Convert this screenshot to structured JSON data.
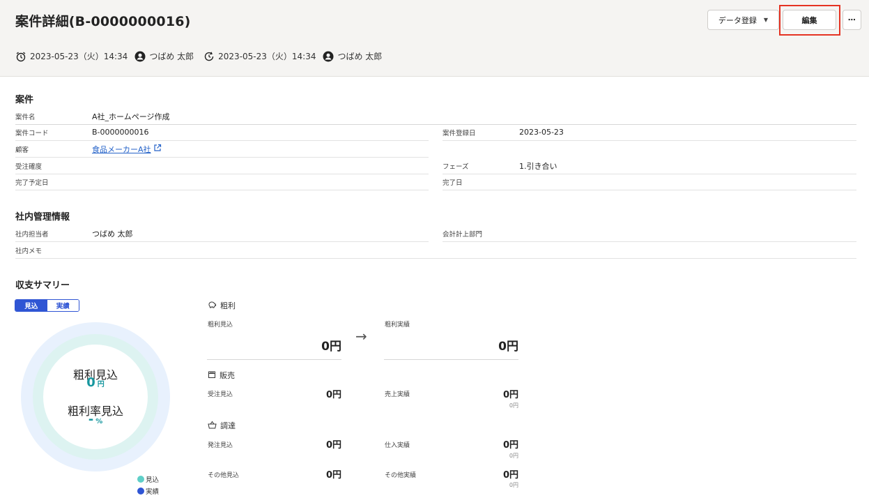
{
  "page": {
    "title": "案件詳細(B-0000000016)",
    "created_at": "2023-05-23（火）14:34",
    "created_by": "つばめ 太郎",
    "updated_at": "2023-05-23（火）14:34",
    "updated_by": "つばめ 太郎"
  },
  "toolbar": {
    "data_register_label": "データ登録",
    "edit_label": "編集",
    "more_label": "⋯"
  },
  "project": {
    "section_title": "案件",
    "name_label": "案件名",
    "name_value": "A社_ホームページ作成",
    "code_label": "案件コード",
    "code_value": "B-0000000016",
    "reg_date_label": "案件登録日",
    "reg_date_value": "2023-05-23",
    "customer_label": "顧客",
    "customer_value": "食品メーカーA社",
    "certainty_label": "受注確度",
    "phase_label": "フェーズ",
    "phase_value": "1.引き合い",
    "due_label": "完了予定日",
    "done_label": "完了日"
  },
  "internal": {
    "section_title": "社内管理情報",
    "staff_label": "社内担当者",
    "staff_value": "つばめ 太郎",
    "dept_label": "会計計上部門",
    "memo_label": "社内メモ"
  },
  "summary": {
    "section_title": "収支サマリー",
    "toggle_plan": "見込",
    "toggle_actual": "実績",
    "donut_profit_label": "粗利見込",
    "donut_profit_value": "0",
    "donut_profit_unit": "円",
    "donut_rate_label": "粗利率見込",
    "donut_rate_value": "-",
    "donut_rate_unit": "%",
    "legend_plan": "見込",
    "legend_actual": "実績",
    "profit_head": "粗利",
    "profit_plan_label": "粗利見込",
    "profit_plan_value": "0円",
    "profit_actual_label": "粗利実績",
    "profit_actual_value": "0円",
    "sales_head": "販売",
    "order_plan_label": "受注見込",
    "order_plan_value": "0円",
    "sales_actual_label": "売上実績",
    "sales_actual_value": "0円",
    "sales_actual_sub": "0円",
    "proc_head": "調達",
    "po_plan_label": "発注見込",
    "po_plan_value": "0円",
    "purchase_actual_label": "仕入実績",
    "purchase_actual_value": "0円",
    "purchase_actual_sub": "0円",
    "other_plan_label": "その他見込",
    "other_plan_value": "0円",
    "other_actual_label": "その他実績",
    "other_actual_value": "0円",
    "other_actual_sub": "0円"
  },
  "colors": {
    "accent": "#2f55d4",
    "teal": "#17979f",
    "edit_highlight": "#e53323"
  },
  "icons": {
    "created": "alarm-clock-icon",
    "updated": "refresh-clock-icon",
    "user": "user-circle-icon",
    "external": "external-link-icon",
    "profit": "piggy-bank-icon",
    "sales": "store-icon",
    "procurement": "basket-icon",
    "arrow": "arrow-right-icon"
  }
}
